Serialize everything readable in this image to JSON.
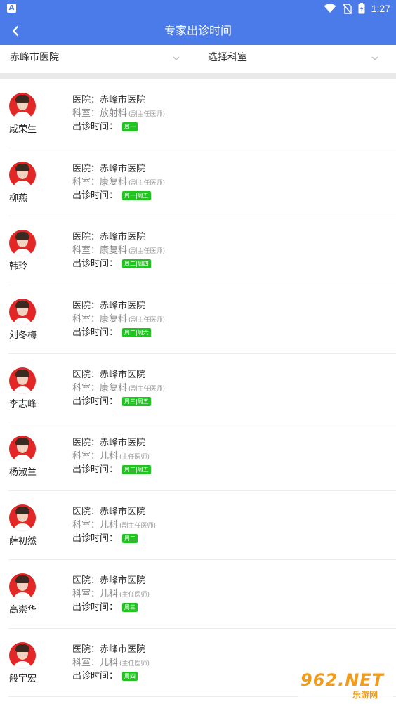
{
  "status_bar": {
    "time": "1:27",
    "app_icon_letter": "A"
  },
  "header": {
    "title": "专家出诊时间",
    "back_icon": "chevron-left-icon"
  },
  "filters": {
    "hospital": "赤峰市医院",
    "department": "选择科室"
  },
  "labels": {
    "hospital_prefix": "医院：",
    "department_prefix": "科室：",
    "time_prefix": "出诊时间："
  },
  "doctors": [
    {
      "name": "咸荣生",
      "hospital": "赤峰市医院",
      "department": "放射科",
      "title": "(副主任医师)",
      "schedule": "周一"
    },
    {
      "name": "柳燕",
      "hospital": "赤峰市医院",
      "department": "康复科",
      "title": "(副主任医师)",
      "schedule": "周一|周五"
    },
    {
      "name": "韩玲",
      "hospital": "赤峰市医院",
      "department": "康复科",
      "title": "(副主任医师)",
      "schedule": "周二|周四"
    },
    {
      "name": "刘冬梅",
      "hospital": "赤峰市医院",
      "department": "康复科",
      "title": "(副主任医师)",
      "schedule": "周二|周六"
    },
    {
      "name": "李志峰",
      "hospital": "赤峰市医院",
      "department": "康复科",
      "title": "(副主任医师)",
      "schedule": "周三|周五"
    },
    {
      "name": "杨淑兰",
      "hospital": "赤峰市医院",
      "department": "儿科",
      "title": "(主任医师)",
      "schedule": "周二|周五"
    },
    {
      "name": "萨初然",
      "hospital": "赤峰市医院",
      "department": "儿科",
      "title": "(副主任医师)",
      "schedule": "周二"
    },
    {
      "name": "高崇华",
      "hospital": "赤峰市医院",
      "department": "儿科",
      "title": "(主任医师)",
      "schedule": "周三"
    },
    {
      "name": "般宇宏",
      "hospital": "赤峰市医院",
      "department": "儿科",
      "title": "(主任医师)",
      "schedule": "周四"
    }
  ],
  "watermark": {
    "top": "962.NET",
    "bottom": "乐游网"
  },
  "colors": {
    "primary": "#4a7be8",
    "badge": "#1fc41f",
    "avatar_bg": "#e32626",
    "watermark": "#f29b1b"
  }
}
